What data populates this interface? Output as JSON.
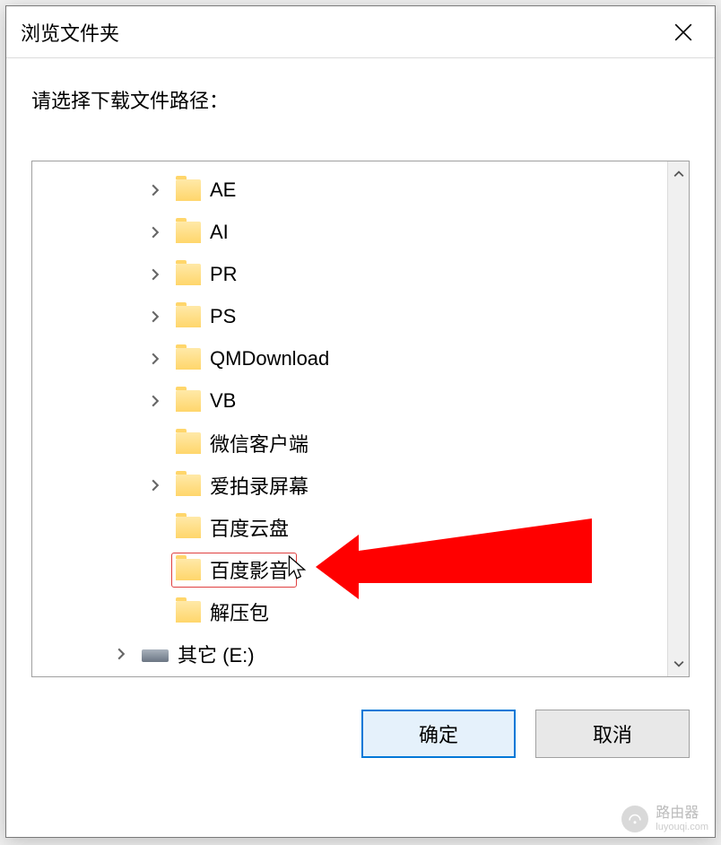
{
  "titlebar": {
    "title": "浏览文件夹"
  },
  "prompt": "请选择下载文件路径：",
  "tree": {
    "indent_base": 126,
    "drive_indent": 88,
    "items": [
      {
        "label": "AE",
        "expandable": true,
        "type": "folder"
      },
      {
        "label": "AI",
        "expandable": true,
        "type": "folder"
      },
      {
        "label": "PR",
        "expandable": true,
        "type": "folder"
      },
      {
        "label": "PS",
        "expandable": true,
        "type": "folder"
      },
      {
        "label": "QMDownload",
        "expandable": true,
        "type": "folder"
      },
      {
        "label": "VB",
        "expandable": true,
        "type": "folder"
      },
      {
        "label": "微信客户端",
        "expandable": false,
        "type": "folder"
      },
      {
        "label": "爱拍录屏幕",
        "expandable": true,
        "type": "folder"
      },
      {
        "label": "百度云盘",
        "expandable": false,
        "type": "folder"
      },
      {
        "label": "百度影音",
        "expandable": false,
        "type": "folder",
        "selected": true
      },
      {
        "label": "解压包",
        "expandable": false,
        "type": "folder"
      },
      {
        "label": "其它 (E:)",
        "expandable": true,
        "type": "drive"
      }
    ]
  },
  "buttons": {
    "ok": "确定",
    "cancel": "取消"
  },
  "watermark": {
    "name": "路由器",
    "sub": "luyouqi.com"
  }
}
